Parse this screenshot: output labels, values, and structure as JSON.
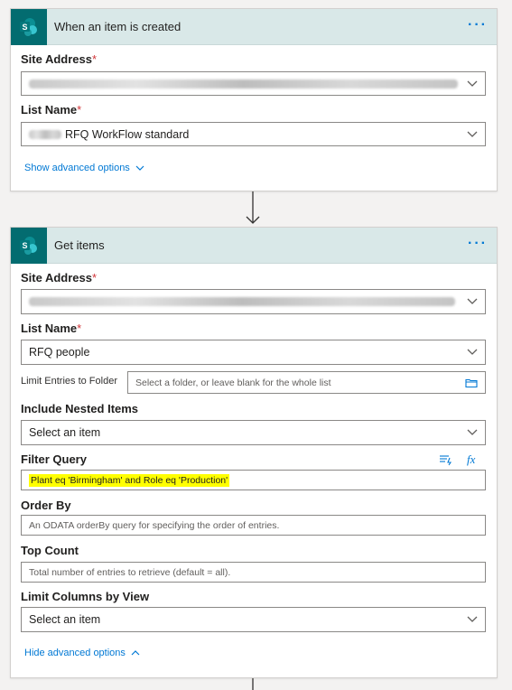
{
  "colors": {
    "accent": "#0078d4",
    "sharepoint": "#036c70",
    "header_bg": "#d9e8e8",
    "required": "#d13438",
    "highlight": "#ffff00"
  },
  "trigger_card": {
    "title": "When an item is created",
    "icon": "sharepoint-icon",
    "more_icon": "ellipsis-icon",
    "site_address_label": "Site Address",
    "list_name_label": "List Name",
    "list_name_value": "RFQ WorkFlow standard",
    "advanced_link": "Show advanced options"
  },
  "get_items_card": {
    "title": "Get items",
    "icon": "sharepoint-icon",
    "more_icon": "ellipsis-icon",
    "site_address_label": "Site Address",
    "list_name_label": "List Name",
    "list_name_value": "RFQ people",
    "limit_folder_label": "Limit Entries to Folder",
    "limit_folder_placeholder": "Select a folder, or leave blank for the whole list",
    "nested_label": "Include Nested Items",
    "nested_value": "Select an item",
    "filter_label": "Filter Query",
    "filter_value": "Plant eq 'Birmingham' and Role eq 'Production'",
    "order_label": "Order By",
    "order_placeholder": "An ODATA orderBy query for specifying the order of entries.",
    "top_label": "Top Count",
    "top_placeholder": "Total number of entries to retrieve (default = all).",
    "columns_label": "Limit Columns by View",
    "columns_value": "Select an item",
    "advanced_link": "Hide advanced options",
    "required_mark": "*",
    "fx_label": "fx"
  }
}
